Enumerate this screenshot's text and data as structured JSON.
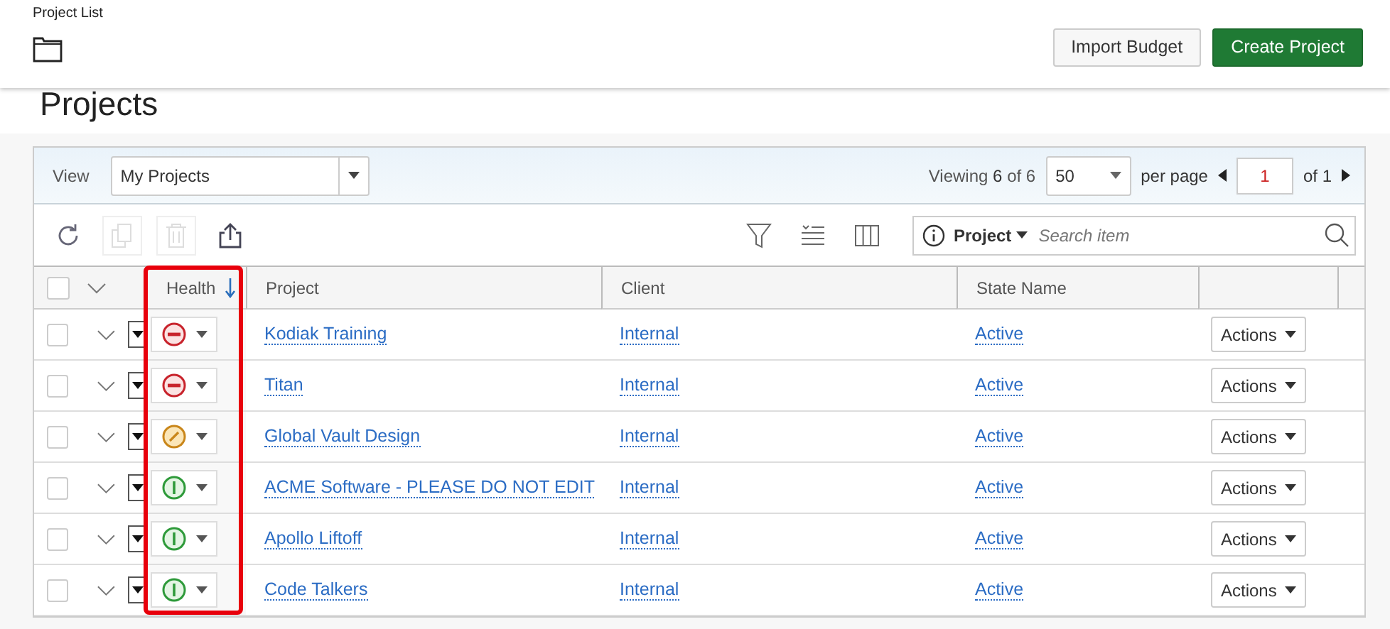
{
  "breadcrumb": "Project List",
  "header_buttons": [
    {
      "label": "Import Budget",
      "kind": "secondary"
    },
    {
      "label": "Create Project",
      "kind": "primary"
    }
  ],
  "page_title": "Projects",
  "view": {
    "label": "View",
    "value": "My Projects"
  },
  "pager": {
    "viewing_label": "Viewing",
    "shown": "6",
    "of_label": "of",
    "total": "6",
    "page_size": "50",
    "per_page_label": "per page",
    "page": "1",
    "of_pages": "of 1"
  },
  "search": {
    "field": "Project",
    "placeholder": "Search item"
  },
  "select_all": {
    "checked": false
  },
  "columns": [
    {
      "label": "Health",
      "sorted": true,
      "highlighted": true
    },
    {
      "label": "Project",
      "sorted": false,
      "highlighted": false
    },
    {
      "label": "Client",
      "sorted": false,
      "highlighted": false
    },
    {
      "label": "State Name",
      "sorted": false,
      "highlighted": false
    }
  ],
  "rows": [
    {
      "health": {
        "kind": "critical"
      },
      "project": "Kodiak Training",
      "client": "Internal",
      "state": "Active",
      "action": "Actions",
      "checked": false
    },
    {
      "health": {
        "kind": "critical"
      },
      "project": "Titan",
      "client": "Internal",
      "state": "Active",
      "action": "Actions",
      "checked": false
    },
    {
      "health": {
        "kind": "warning"
      },
      "project": "Global Vault Design",
      "client": "Internal",
      "state": "Active",
      "action": "Actions",
      "checked": false
    },
    {
      "health": {
        "kind": "good"
      },
      "project": "ACME Software - PLEASE DO NOT EDIT",
      "client": "Internal",
      "state": "Active",
      "action": "Actions",
      "checked": false
    },
    {
      "health": {
        "kind": "good"
      },
      "project": "Apollo Liftoff",
      "client": "Internal",
      "state": "Active",
      "action": "Actions",
      "checked": false
    },
    {
      "health": {
        "kind": "good"
      },
      "project": "Code Talkers",
      "client": "Internal",
      "state": "Active",
      "action": "Actions",
      "checked": false
    }
  ]
}
